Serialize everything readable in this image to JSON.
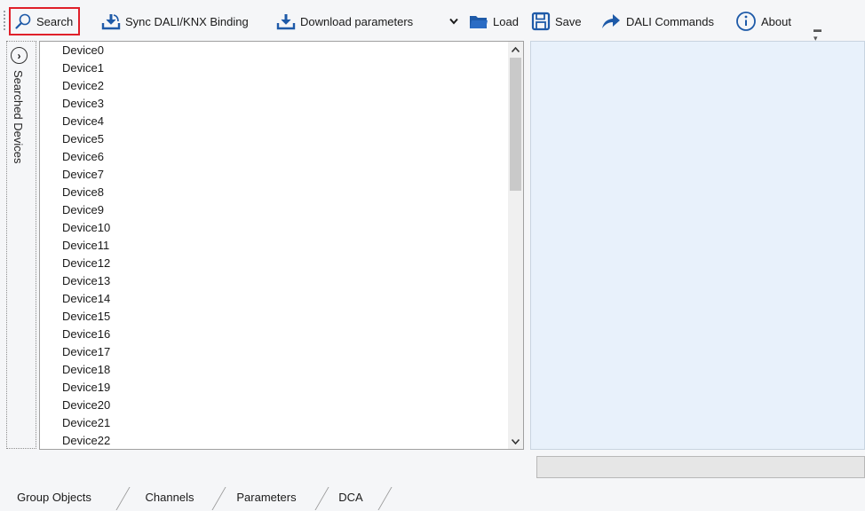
{
  "toolbar": {
    "search_label": "Search",
    "sync_label": "Sync DALI/KNX Binding",
    "download_label": "Download parameters",
    "load_label": "Load",
    "save_label": "Save",
    "dali_commands_label": "DALI Commands",
    "about_label": "About"
  },
  "side_panel": {
    "label": "Searched Devices",
    "expand_glyph": "›"
  },
  "devices": [
    "Device0",
    "Device1",
    "Device2",
    "Device3",
    "Device4",
    "Device5",
    "Device6",
    "Device7",
    "Device8",
    "Device9",
    "Device10",
    "Device11",
    "Device12",
    "Device13",
    "Device14",
    "Device15",
    "Device16",
    "Device17",
    "Device18",
    "Device19",
    "Device20",
    "Device21",
    "Device22"
  ],
  "tabs": [
    {
      "label": "Group Objects"
    },
    {
      "label": "Channels"
    },
    {
      "label": "Parameters"
    },
    {
      "label": "DCA",
      "active": true
    }
  ],
  "colors": {
    "selection_border": "#e0202a",
    "icon_blue": "#1e5aa8",
    "panel_bg": "#e8f1fb"
  }
}
